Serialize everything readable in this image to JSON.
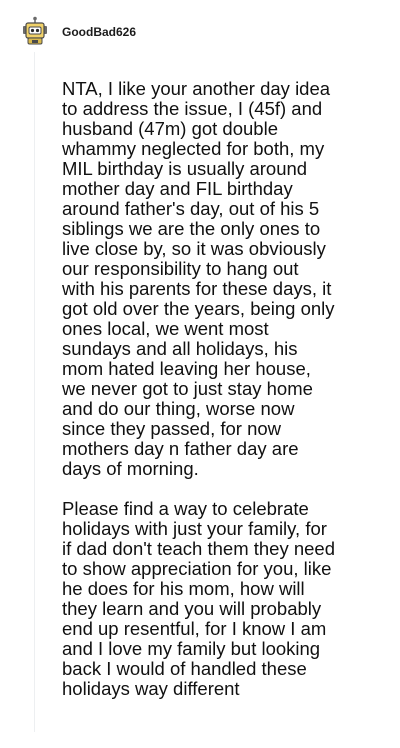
{
  "comment": {
    "author": "GoodBad626",
    "avatar_icon": "snoo-avatar-icon",
    "paragraphs": [
      "NTA, I like your another day idea\nto address the issue, I (45f) and\nhusband (47m) got double\nwhammy neglected for both, my\nMIL birthday is usually around\nmother day and FIL birthday\naround father's day, out of his 5\nsiblings we are the only ones to\nlive close by, so it was obviously\nour responsibility to hang out\nwith his parents for these days, it\ngot old over the years, being only\nones local, we went most\nsundays and all holidays, his\nmom hated leaving her house,\nwe never got to just stay home\nand do our thing, worse now\nsince they passed, for now\nmothers day n father day are\ndays of morning.",
      "Please find a way to celebrate\nholidays with just your family, for\nif dad don't teach them they need\nto show appreciation for you, like\nhe does for his mom, how will\nthey learn and you will probably\nend up resentful, for I know I am\nand I love my family but looking\nback I would of handled these\nholidays way different"
    ]
  },
  "colors": {
    "text": "#111111",
    "username": "#1c1c1c",
    "thread_line": "#edeff1",
    "background": "#ffffff"
  }
}
